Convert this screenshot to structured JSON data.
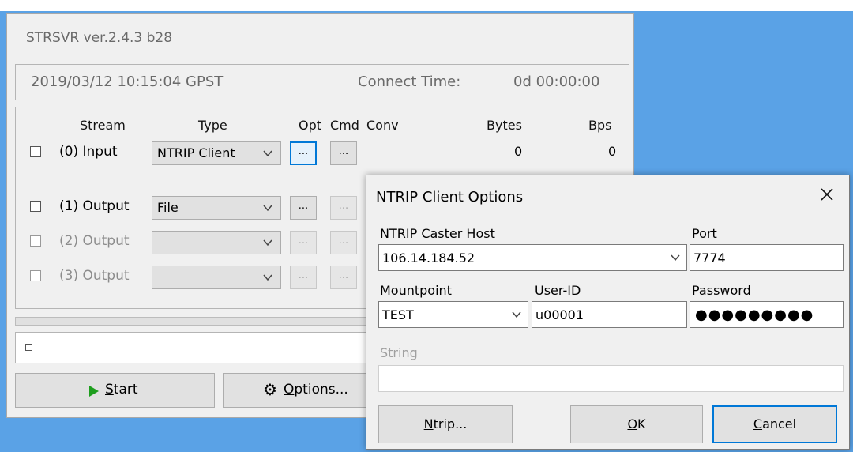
{
  "window": {
    "title": "STRSVR ver.2.4.3 b28",
    "datetime": "2019/03/12 10:15:04 GPST",
    "connect_label": "Connect Time:",
    "connect_value": "0d 00:00:00"
  },
  "headers": {
    "stream": "Stream",
    "type": "Type",
    "opt": "Opt",
    "cmd": "Cmd",
    "conv": "Conv",
    "bytes": "Bytes",
    "bps": "Bps"
  },
  "rows": [
    {
      "label": "(0) Input",
      "type": "NTRIP Client",
      "opt": "...",
      "cmd": "...",
      "bytes": "0",
      "bps": "0"
    },
    {
      "label": "(1) Output",
      "type": "File",
      "opt": "...",
      "cmd": "..."
    },
    {
      "label": "(2) Output",
      "type": "",
      "opt": "...",
      "cmd": "..."
    },
    {
      "label": "(3) Output",
      "type": "",
      "opt": "...",
      "cmd": "..."
    }
  ],
  "buttons": {
    "start_u": "S",
    "start_rest": "tart",
    "options_u": "O",
    "options_rest": "ptions..."
  },
  "dialog": {
    "title": "NTRIP Client Options",
    "host_label": "NTRIP Caster Host",
    "host_value": "106.14.184.52",
    "port_label": "Port",
    "port_value": "7774",
    "mount_label": "Mountpoint",
    "mount_value": "TEST",
    "user_label": "User-ID",
    "user_value": "u00001",
    "pass_label": "Password",
    "pass_value": "●●●●●●●●●",
    "string_label": "String",
    "string_value": "",
    "ntrip_u": "N",
    "ntrip_rest": "trip...",
    "ok_u": "O",
    "ok_rest": "K",
    "cancel_u": "C",
    "cancel_rest": "ancel"
  },
  "colors": {
    "desktop": "#5aa2e6",
    "focus": "#0078d7",
    "play": "#1e9e1e"
  },
  "icons": {
    "start": "play-icon",
    "options": "gear-icon",
    "close": "close-icon",
    "dropdown": "chevron-down-icon"
  }
}
